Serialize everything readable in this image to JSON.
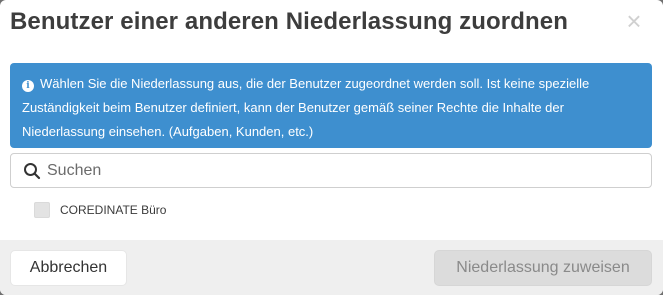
{
  "dialog": {
    "title": "Benutzer einer anderen Niederlassung zuordnen",
    "close_symbol": "×"
  },
  "info": {
    "icon": "info-icon",
    "text": "Wählen Sie die Niederlassung aus, die der Benutzer zugeordnet werden soll. Ist keine spezielle Zuständigkeit beim Benutzer definiert, kann der Benutzer gemäß seiner Rechte die Inhalte der Niederlassung einsehen. (Aufgaben, Kunden, etc.)",
    "background_color": "#3e8fcf"
  },
  "search": {
    "placeholder": "Suchen",
    "value": ""
  },
  "options": [
    {
      "label": "COREDINATE Büro",
      "checked": false
    }
  ],
  "footer": {
    "cancel_label": "Abbrechen",
    "assign_label": "Niederlassung zuweisen"
  }
}
